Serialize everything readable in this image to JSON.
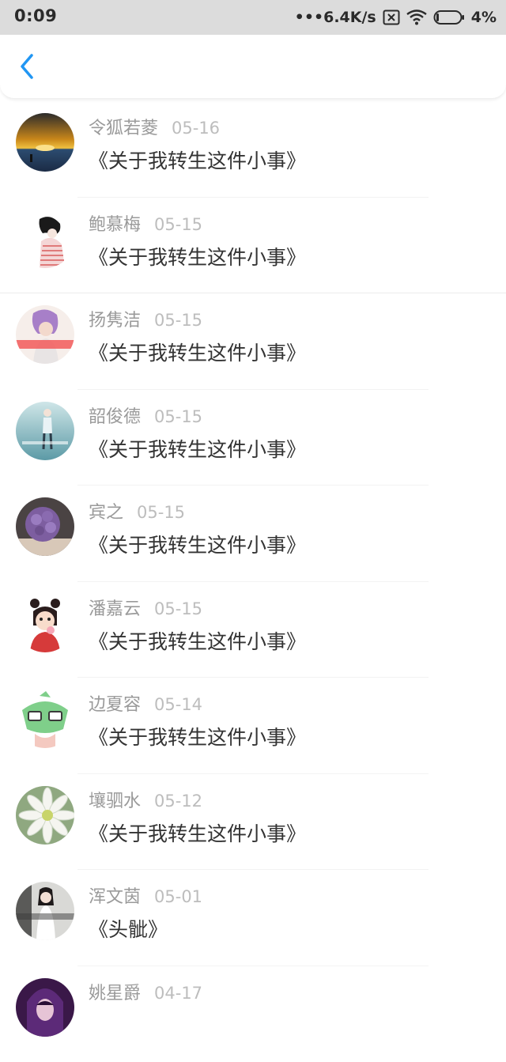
{
  "status_bar": {
    "time": "0:09",
    "network_speed": "•••6.4K/s",
    "battery_percent": "4%",
    "icons": [
      "sim-disabled-icon",
      "wifi-icon",
      "battery-icon"
    ]
  },
  "header": {
    "back_icon": "chevron-left-icon",
    "accent_color": "#2196F3"
  },
  "items": [
    {
      "name": "令狐若菱",
      "date": "05-16",
      "title": "《关于我转生这件小事》",
      "avatar": "sunset-sea-avatar"
    },
    {
      "name": "鲍慕梅",
      "date": "05-15",
      "title": "《关于我转生这件小事》",
      "avatar": "sketch-girl-avatar"
    },
    {
      "name": "扬隽洁",
      "date": "05-15",
      "title": "《关于我转生这件小事》",
      "avatar": "purple-hair-girl-avatar"
    },
    {
      "name": "韶俊德",
      "date": "05-15",
      "title": "《关于我转生这件小事》",
      "avatar": "standing-girl-avatar"
    },
    {
      "name": "宾之",
      "date": "05-15",
      "title": "《关于我转生这件小事》",
      "avatar": "purple-flowers-avatar"
    },
    {
      "name": "潘嘉云",
      "date": "05-15",
      "title": "《关于我转生这件小事》",
      "avatar": "cartoon-girl-icecream-avatar"
    },
    {
      "name": "边夏容",
      "date": "05-14",
      "title": "《关于我转生这件小事》",
      "avatar": "green-cartoon-glasses-avatar"
    },
    {
      "name": "壤驷水",
      "date": "05-12",
      "title": "《关于我转生这件小事》",
      "avatar": "white-daisy-avatar"
    },
    {
      "name": "浑文茵",
      "date": "05-01",
      "title": "《头骴》",
      "avatar": "girl-photo-avatar"
    },
    {
      "name": "姚星爵",
      "date": "04-17",
      "title": "",
      "avatar": "purple-portrait-avatar"
    }
  ]
}
